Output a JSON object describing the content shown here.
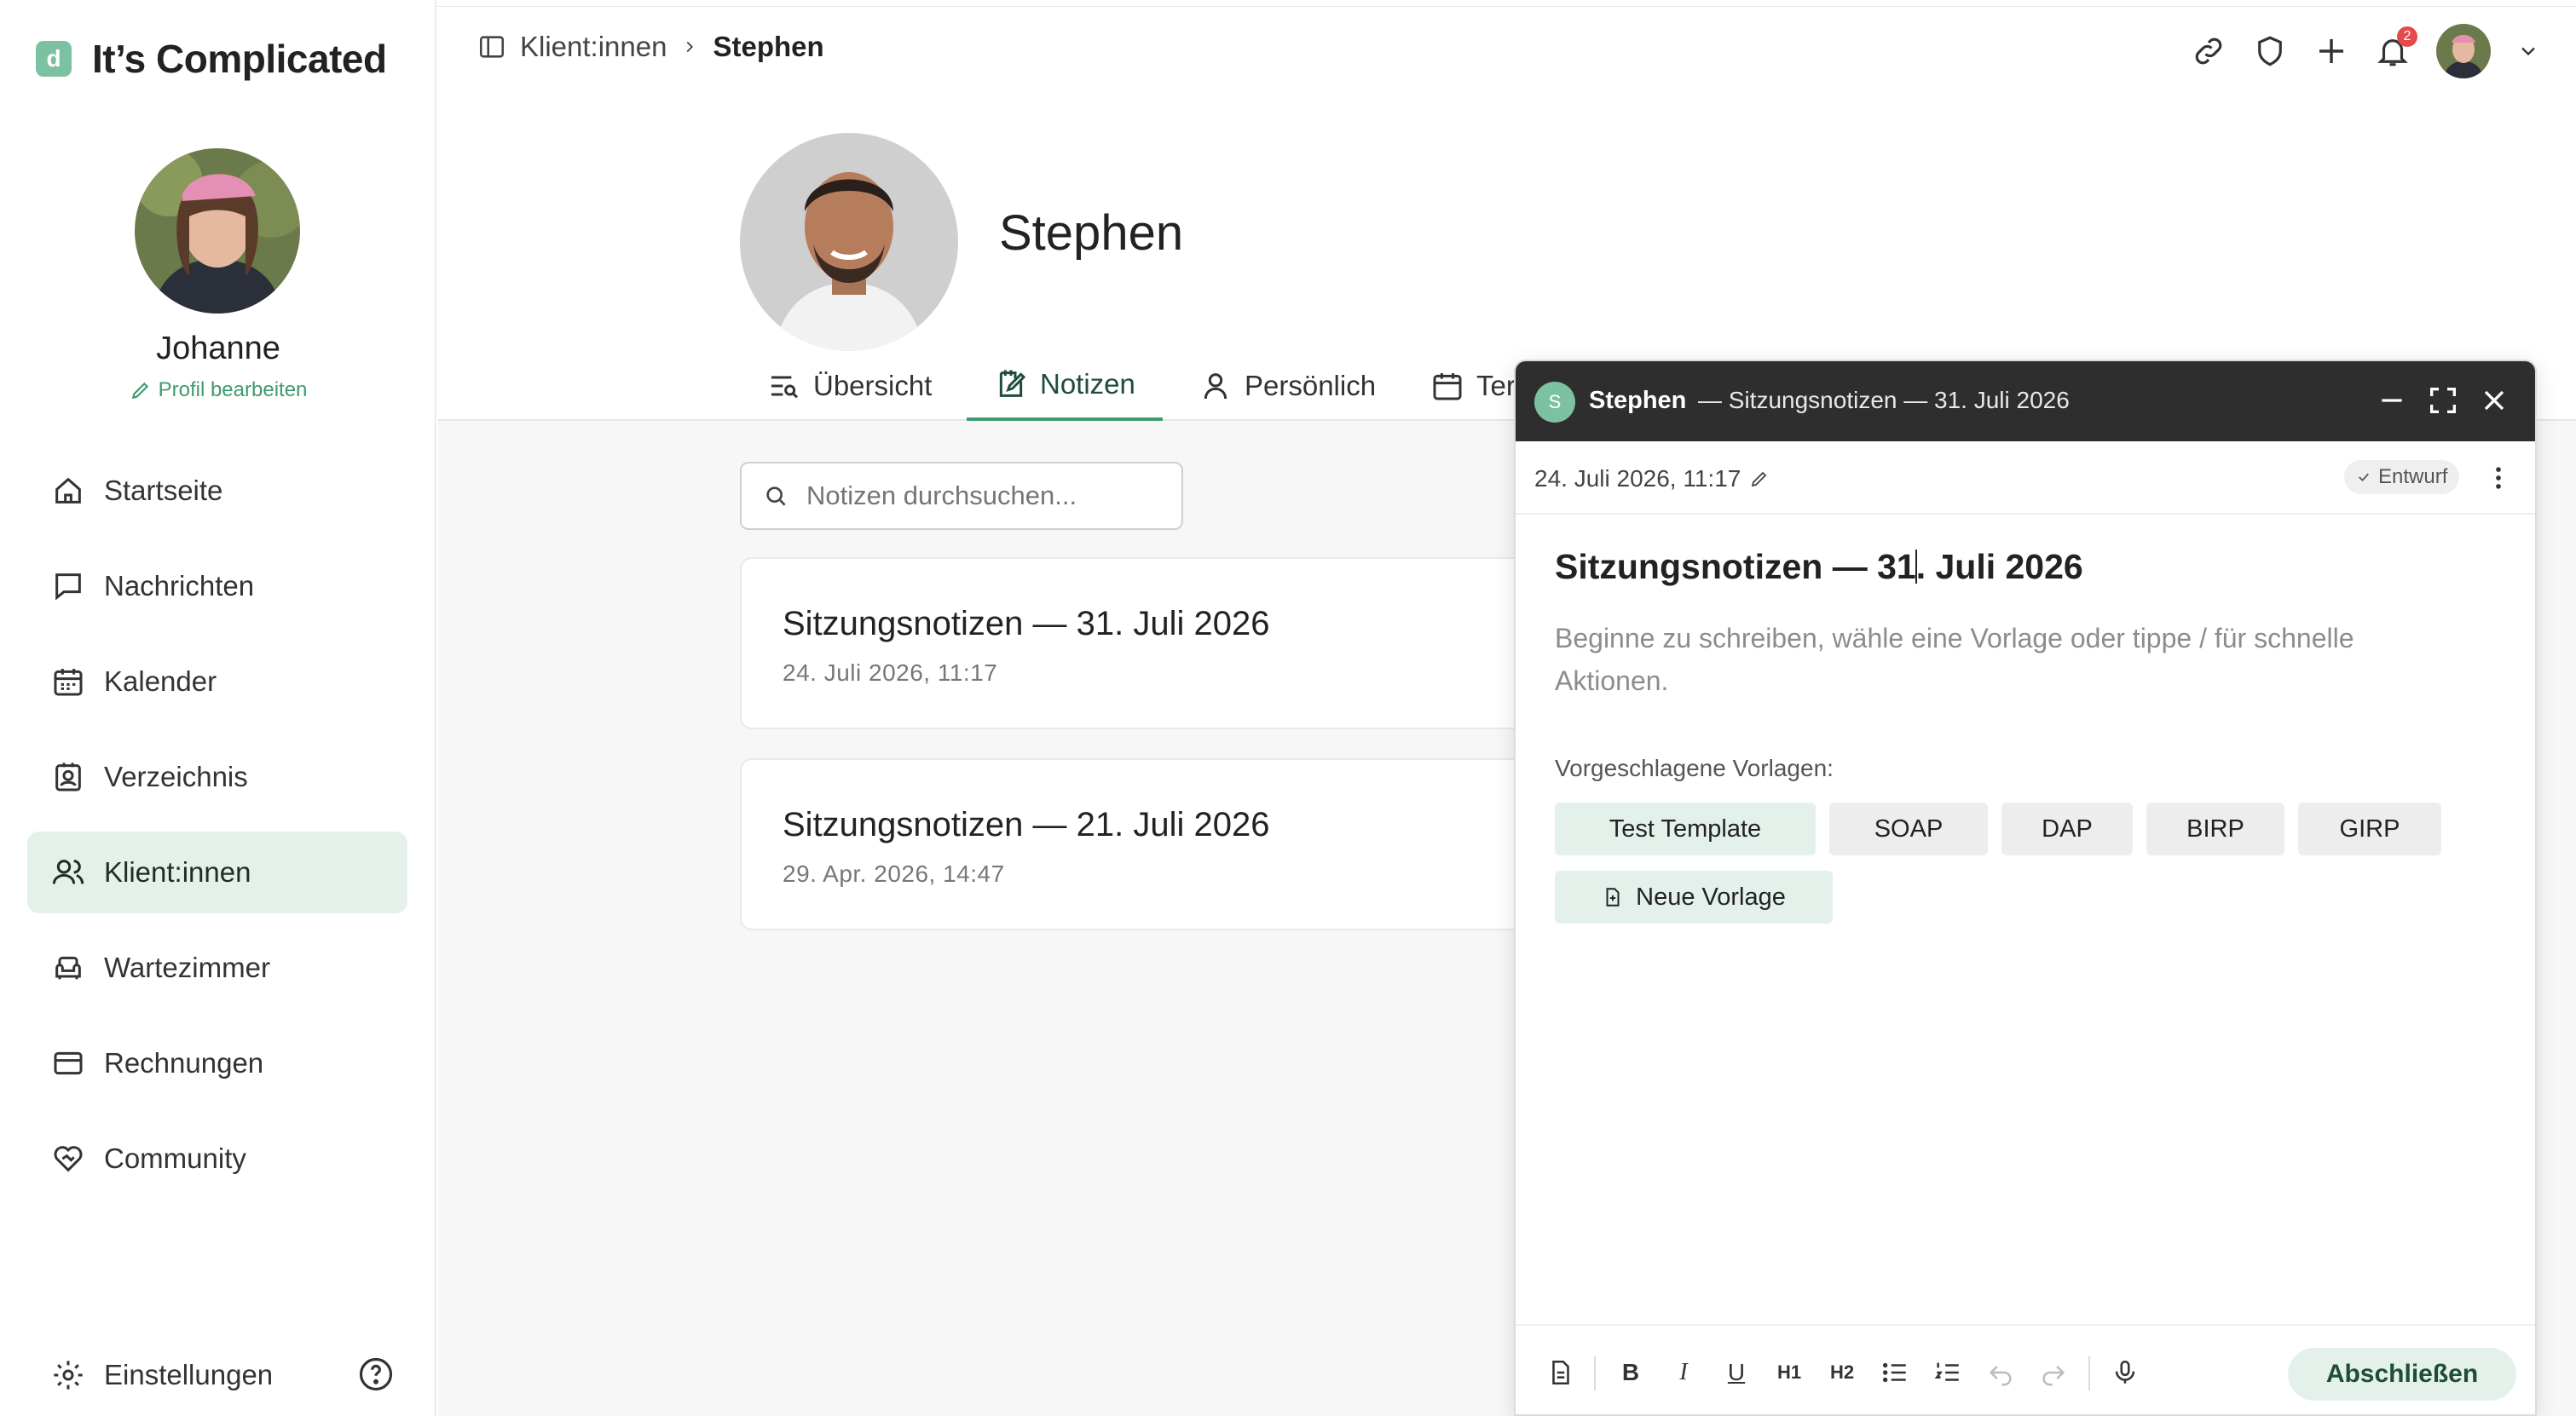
{
  "brand": {
    "logo_letter": "d",
    "name": "It’s Complicated"
  },
  "user": {
    "name": "Johanne",
    "edit_label": "Profil bearbeiten"
  },
  "sidebar": {
    "items": [
      {
        "label": "Startseite",
        "icon": "home-icon"
      },
      {
        "label": "Nachrichten",
        "icon": "message-icon"
      },
      {
        "label": "Kalender",
        "icon": "calendar-icon"
      },
      {
        "label": "Verzeichnis",
        "icon": "directory-icon"
      },
      {
        "label": "Klient:innen",
        "icon": "clients-icon",
        "active": true
      },
      {
        "label": "Wartezimmer",
        "icon": "waiting-room-icon"
      },
      {
        "label": "Rechnungen",
        "icon": "billing-icon"
      },
      {
        "label": "Community",
        "icon": "community-icon"
      }
    ],
    "settings_label": "Einstellungen"
  },
  "breadcrumb": {
    "parent": "Klient:innen",
    "current": "Stephen"
  },
  "header": {
    "notification_count": "2"
  },
  "client": {
    "name": "Stephen"
  },
  "tabs": [
    {
      "label": "Übersicht"
    },
    {
      "label": "Notizen",
      "active": true
    },
    {
      "label": "Persönlich"
    },
    {
      "label": "Ter"
    }
  ],
  "search": {
    "placeholder": "Notizen durchsuchen..."
  },
  "notes": [
    {
      "title": "Sitzungsnotizen — 31. Juli 2026",
      "date": "24. Juli 2026, 11:17"
    },
    {
      "title": "Sitzungsnotizen — 21. Juli 2026",
      "date": "29. Apr. 2026, 14:47"
    }
  ],
  "editor": {
    "avatar_letter": "S",
    "client": "Stephen",
    "subtitle": "— Sitzungsnotizen — 31. Juli 2026",
    "timestamp": "24. Juli 2026, 11:17",
    "status": "Entwurf",
    "doc_title_a": "Sitzungsnotizen — 31",
    "doc_title_b": ". Juli 2026",
    "placeholder": "Beginne zu schreiben, wähle eine Vorlage oder tippe / für schnelle Aktionen.",
    "templates_label": "Vorgeschlagene Vorlagen:",
    "templates": [
      "Test Template",
      "SOAP",
      "DAP",
      "BIRP",
      "GIRP"
    ],
    "new_template": "Neue Vorlage",
    "toolbar": {
      "h1": "H1",
      "h2": "H2",
      "bold": "B",
      "italic": "I",
      "underline": "U"
    },
    "finish_label": "Abschließen"
  },
  "colors": {
    "accent": "#3f9a6f",
    "accent_light": "#e3f1ea",
    "panel_header": "#2e2e2e",
    "badge": "#e34b4b"
  }
}
